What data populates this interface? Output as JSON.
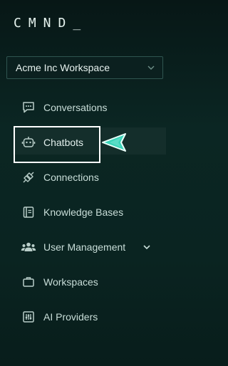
{
  "app": {
    "logo_text": "CMND_"
  },
  "workspace": {
    "label": "Acme Inc Workspace"
  },
  "nav": {
    "items": [
      {
        "label": "Conversations",
        "icon": "chat-bubble-icon"
      },
      {
        "label": "Chatbots",
        "icon": "robot-icon"
      },
      {
        "label": "Connections",
        "icon": "plug-icon"
      },
      {
        "label": "Knowledge Bases",
        "icon": "book-icon"
      },
      {
        "label": "User Management",
        "icon": "users-icon"
      },
      {
        "label": "Workspaces",
        "icon": "briefcase-icon"
      },
      {
        "label": "AI Providers",
        "icon": "sliders-icon"
      }
    ]
  },
  "colors": {
    "background": "#0b2623",
    "text": "#c9ded9",
    "accent": "#39d3b8",
    "highlight_box": "#ffffff"
  }
}
